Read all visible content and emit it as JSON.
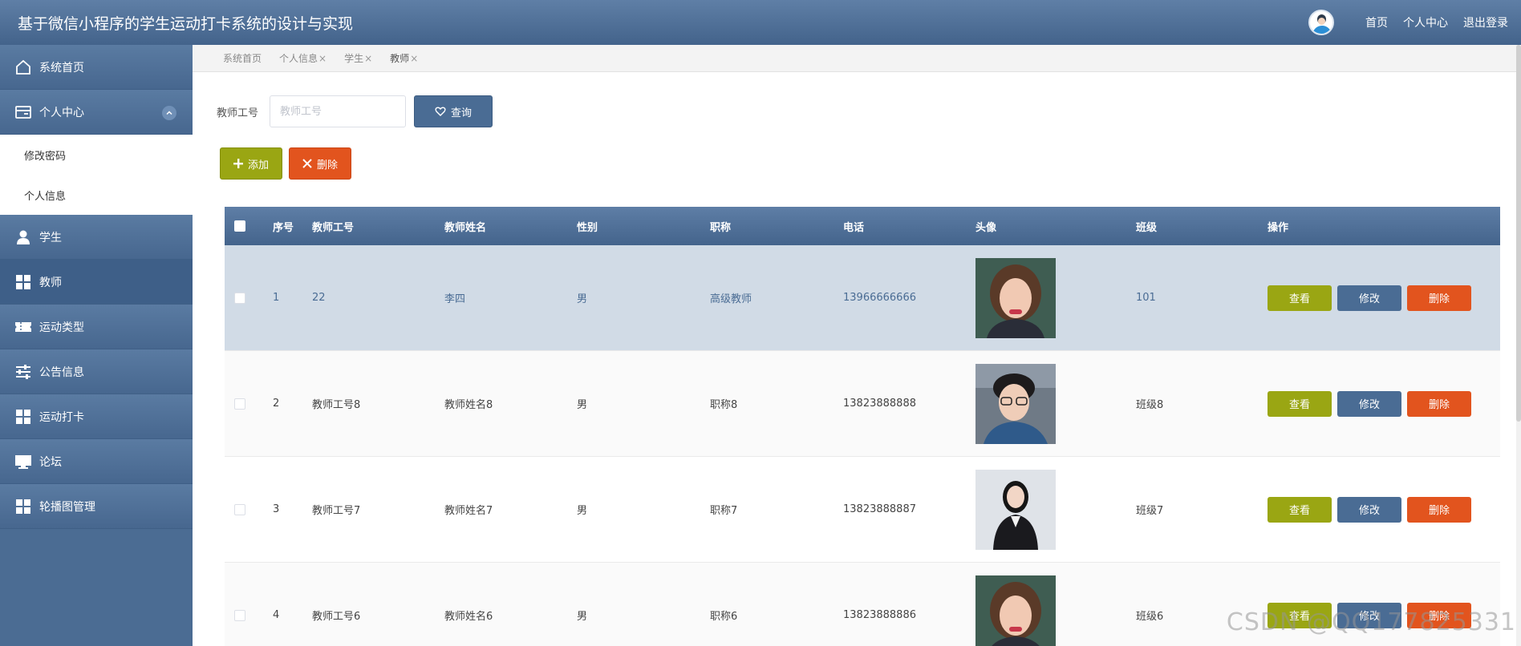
{
  "header": {
    "title": "基于微信小程序的学生运动打卡系统的设计与实现",
    "links": [
      "首页",
      "个人中心",
      "退出登录"
    ]
  },
  "sidebar": {
    "items": [
      {
        "label": "系统首页",
        "icon": "home-icon"
      },
      {
        "label": "个人中心",
        "icon": "card-icon"
      },
      {
        "label": "学生",
        "icon": "user-icon"
      },
      {
        "label": "教师",
        "icon": "grid-icon"
      },
      {
        "label": "运动类型",
        "icon": "ticket-icon"
      },
      {
        "label": "公告信息",
        "icon": "sliders-icon"
      },
      {
        "label": "运动打卡",
        "icon": "grid-icon"
      },
      {
        "label": "论坛",
        "icon": "monitor-icon"
      },
      {
        "label": "轮播图管理",
        "icon": "grid-icon"
      }
    ],
    "subitems": [
      "修改密码",
      "个人信息"
    ]
  },
  "breadcrumbs": [
    {
      "label": "系统首页",
      "closable": false
    },
    {
      "label": "个人信息",
      "closable": true
    },
    {
      "label": "学生",
      "closable": true
    },
    {
      "label": "教师",
      "closable": true
    }
  ],
  "search": {
    "label": "教师工号",
    "placeholder": "教师工号",
    "value": "",
    "query_label": "查询"
  },
  "actions": {
    "add_label": "添加",
    "delete_label": "删除"
  },
  "table": {
    "headers": [
      "序号",
      "教师工号",
      "教师姓名",
      "性别",
      "职称",
      "电话",
      "头像",
      "班级",
      "操作"
    ],
    "row_buttons": {
      "view": "查看",
      "edit": "修改",
      "delete": "删除"
    },
    "rows": [
      {
        "no": "1",
        "id": "22",
        "name": "李四",
        "sex": "男",
        "title": "高级教师",
        "phone": "13966666666",
        "class": "101"
      },
      {
        "no": "2",
        "id": "教师工号8",
        "name": "教师姓名8",
        "sex": "男",
        "title": "职称8",
        "phone": "13823888888",
        "class": "班级8"
      },
      {
        "no": "3",
        "id": "教师工号7",
        "name": "教师姓名7",
        "sex": "男",
        "title": "职称7",
        "phone": "13823888887",
        "class": "班级7"
      },
      {
        "no": "4",
        "id": "教师工号6",
        "name": "教师姓名6",
        "sex": "男",
        "title": "职称6",
        "phone": "13823888886",
        "class": "班级6"
      }
    ]
  },
  "watermark": "CSDN @QQ177825331",
  "colors": {
    "primary": "#4a6c94",
    "success": "#9aa613",
    "danger": "#e2541e"
  }
}
